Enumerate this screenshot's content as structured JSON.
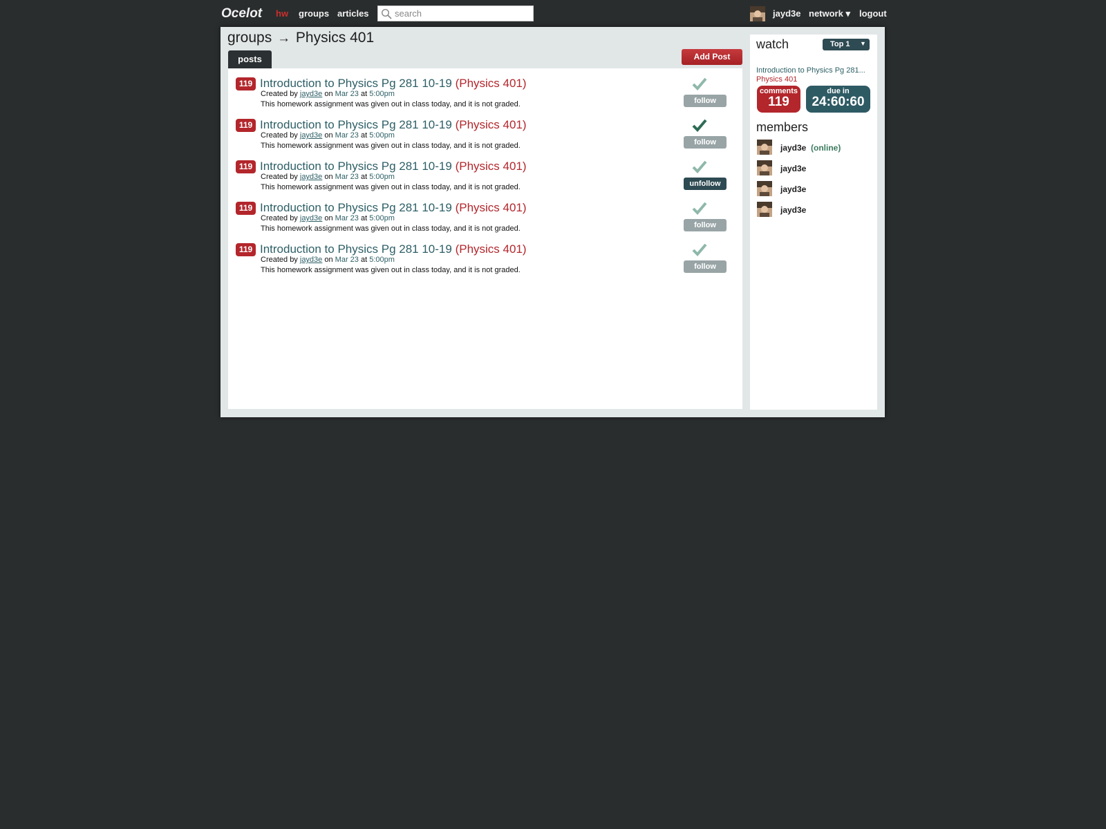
{
  "topbar": {
    "logo": "Ocelot",
    "nav": [
      {
        "label": "hw",
        "active": true
      },
      {
        "label": "groups",
        "active": false
      },
      {
        "label": "articles",
        "active": false
      }
    ],
    "search_placeholder": "search",
    "username": "jayd3e",
    "network_label": "network ▾",
    "logout_label": "logout"
  },
  "breadcrumb": {
    "parent": "groups",
    "separator": "→",
    "current": "Physics 401"
  },
  "tabs": {
    "posts_label": "posts"
  },
  "add_post_label": "Add Post",
  "posts": [
    {
      "count": "119",
      "title": "Introduction to Physics Pg 281 10-19",
      "group": "(Physics 401)",
      "created_by": "Created by",
      "author": "jayd3e",
      "on": "on",
      "date": "Mar 23",
      "at": "at",
      "time": "5:00pm",
      "description": "This homework assignment was given out in class today, and it is not graded.",
      "check_state": "light",
      "button_label": "follow"
    },
    {
      "count": "119",
      "title": "Introduction to Physics Pg 281 10-19",
      "group": "(Physics 401)",
      "created_by": "Created by",
      "author": "jayd3e",
      "on": "on",
      "date": "Mar 23",
      "at": "at",
      "time": "5:00pm",
      "description": "This homework assignment was given out in class today, and it is not graded.",
      "check_state": "dark",
      "button_label": "follow"
    },
    {
      "count": "119",
      "title": "Introduction to Physics Pg 281 10-19",
      "group": "(Physics 401)",
      "created_by": "Created by",
      "author": "jayd3e",
      "on": "on",
      "date": "Mar 23",
      "at": "at",
      "time": "5:00pm",
      "description": "This homework assignment was given out in class today, and it is not graded.",
      "check_state": "light",
      "button_label": "unfollow"
    },
    {
      "count": "119",
      "title": "Introduction to Physics Pg 281 10-19",
      "group": "(Physics 401)",
      "created_by": "Created by",
      "author": "jayd3e",
      "on": "on",
      "date": "Mar 23",
      "at": "at",
      "time": "5:00pm",
      "description": "This homework assignment was given out in class today, and it is not graded.",
      "check_state": "light",
      "button_label": "follow"
    },
    {
      "count": "119",
      "title": "Introduction to Physics Pg 281 10-19",
      "group": "(Physics 401)",
      "created_by": "Created by",
      "author": "jayd3e",
      "on": "on",
      "date": "Mar 23",
      "at": "at",
      "time": "5:00pm",
      "description": "This homework assignment was given out in class today, and it is not graded.",
      "check_state": "light",
      "button_label": "follow"
    }
  ],
  "sidebar": {
    "watch_title": "watch",
    "top_select": "Top 1",
    "watch_link": "Introduction to Physics Pg 281...",
    "watch_group": "Physics 401",
    "comments_label": "comments",
    "comments_value": "119",
    "due_label": "due in",
    "due_value": "24:60:60",
    "members_title": "members",
    "members": [
      {
        "name": "jayd3e",
        "status": "(online)"
      },
      {
        "name": "jayd3e",
        "status": ""
      },
      {
        "name": "jayd3e",
        "status": ""
      },
      {
        "name": "jayd3e",
        "status": ""
      }
    ]
  },
  "colors": {
    "background": "#2a2d2e",
    "accent_red": "#b3262b",
    "accent_teal": "#2d5f66",
    "panel": "#e1e6e7"
  }
}
